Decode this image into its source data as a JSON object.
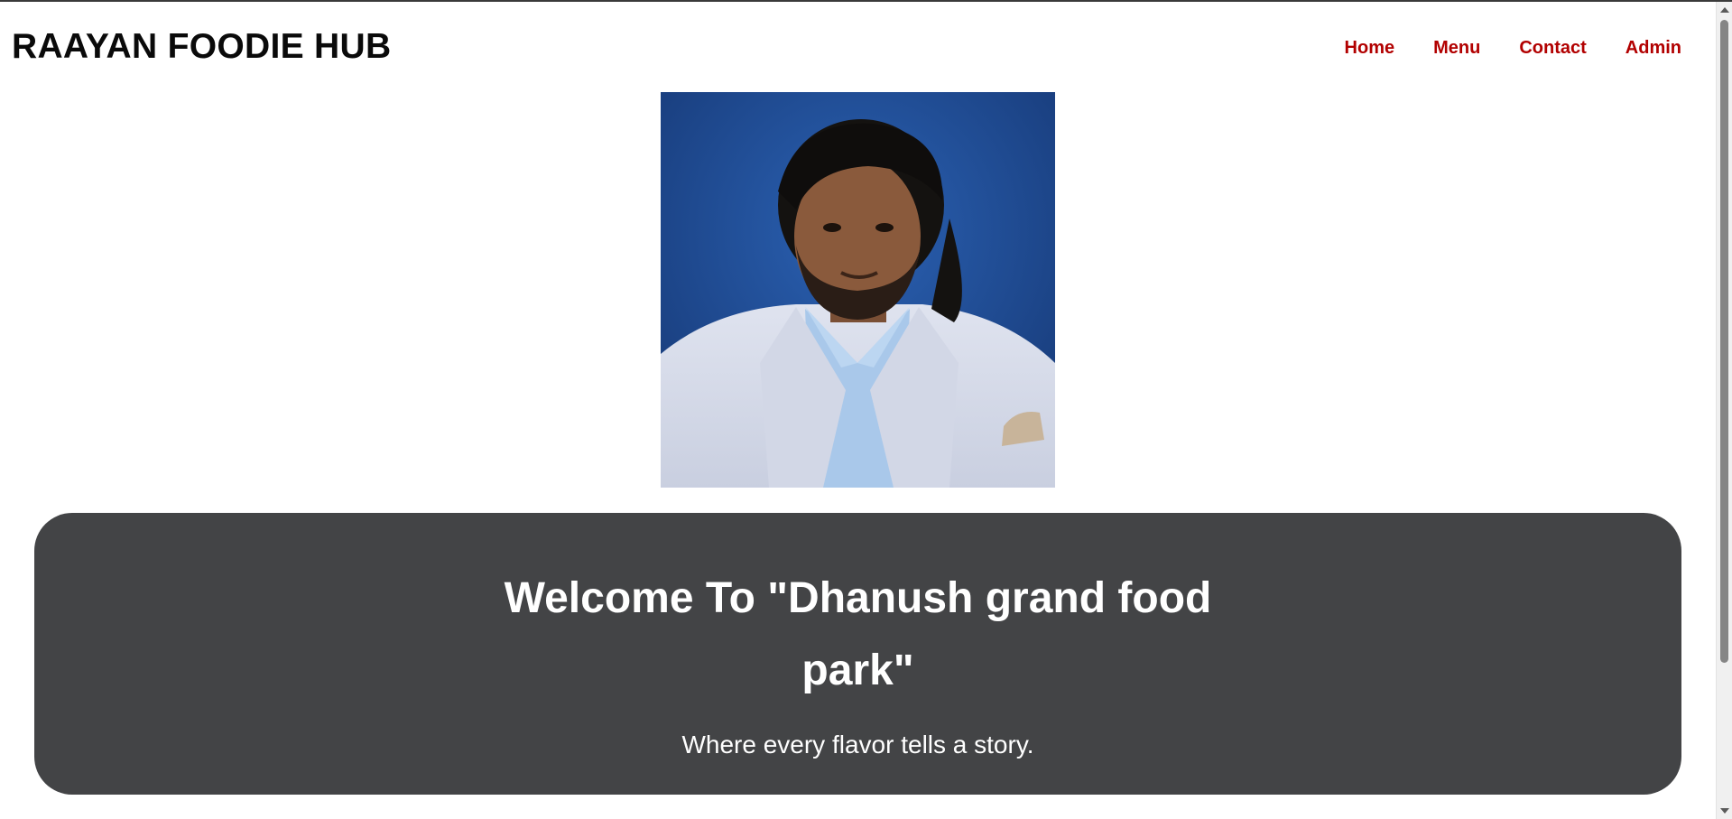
{
  "header": {
    "brand": "RAAYAN FOODIE HUB",
    "nav": [
      {
        "label": "Home"
      },
      {
        "label": "Menu"
      },
      {
        "label": "Contact"
      },
      {
        "label": "Admin"
      }
    ]
  },
  "hero": {
    "image_icon": "portrait-photo-icon",
    "title": "Welcome To \"Dhanush grand food park\"",
    "subtitle": "Where every flavor tells a story."
  },
  "colors": {
    "nav_link": "#b20000",
    "panel_bg": "#434446",
    "panel_text": "#ffffff",
    "brand_text": "#0a0a0a"
  }
}
